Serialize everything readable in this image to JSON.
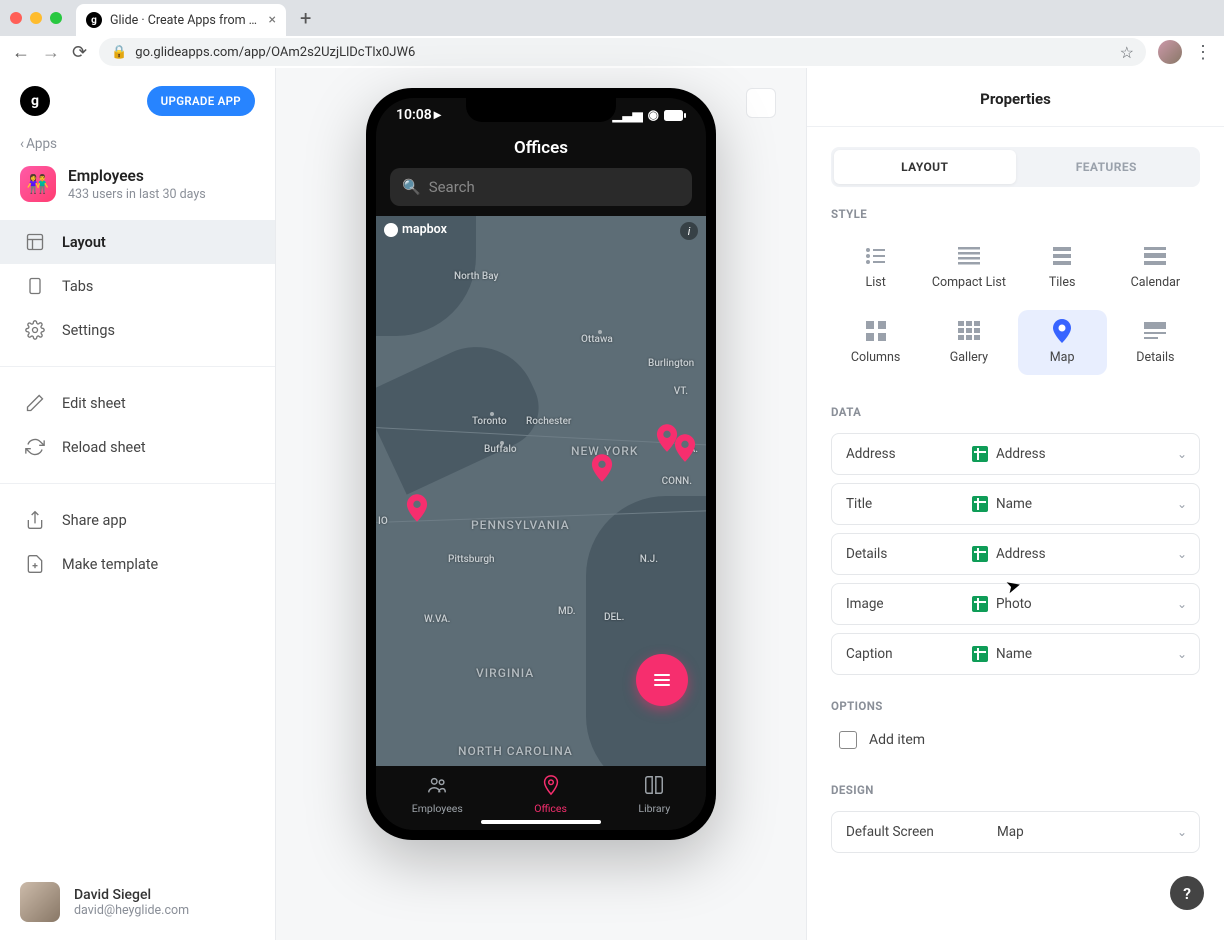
{
  "browser": {
    "tab_title": "Glide · Create Apps from Goog",
    "url": "go.glideapps.com/app/OAm2s2UzjLlDcTlx0JW6"
  },
  "sidebar": {
    "upgrade": "UPGRADE APP",
    "back": "Apps",
    "app_name": "Employees",
    "app_sub": "433 users in last 30 days",
    "items": [
      {
        "label": "Layout"
      },
      {
        "label": "Tabs"
      },
      {
        "label": "Settings"
      },
      {
        "label": "Edit sheet"
      },
      {
        "label": "Reload sheet"
      },
      {
        "label": "Share app"
      },
      {
        "label": "Make template"
      }
    ],
    "user_name": "David Siegel",
    "user_email": "david@heyglide.com"
  },
  "phone": {
    "time": "10:08",
    "title": "Offices",
    "search_placeholder": "Search",
    "map_provider": "mapbox",
    "labels": [
      "North Bay",
      "Ottawa",
      "Burlington",
      "VT.",
      "Toronto",
      "Rochester",
      "Buffalo",
      "NEW YORK",
      "CONN.",
      "MA.",
      "PENNSYLVANIA",
      "Pittsburgh",
      "N.J.",
      "MD.",
      "DEL.",
      "W.VA.",
      "VIRGINIA",
      "NORTH CAROLINA",
      "IO"
    ],
    "tabs": [
      {
        "label": "Employees"
      },
      {
        "label": "Offices"
      },
      {
        "label": "Library"
      }
    ]
  },
  "props": {
    "title": "Properties",
    "tabs": {
      "layout": "LAYOUT",
      "features": "FEATURES"
    },
    "sections": {
      "style": "STYLE",
      "data": "DATA",
      "options": "OPTIONS",
      "design": "DESIGN"
    },
    "styles": [
      "List",
      "Compact List",
      "Tiles",
      "Calendar",
      "Columns",
      "Gallery",
      "Map",
      "Details"
    ],
    "data_rows": [
      {
        "label": "Address",
        "value": "Address"
      },
      {
        "label": "Title",
        "value": "Name"
      },
      {
        "label": "Details",
        "value": "Address"
      },
      {
        "label": "Image",
        "value": "Photo"
      },
      {
        "label": "Caption",
        "value": "Name"
      }
    ],
    "options": {
      "add_item": "Add item"
    },
    "design": {
      "label": "Default Screen",
      "value": "Map"
    }
  }
}
